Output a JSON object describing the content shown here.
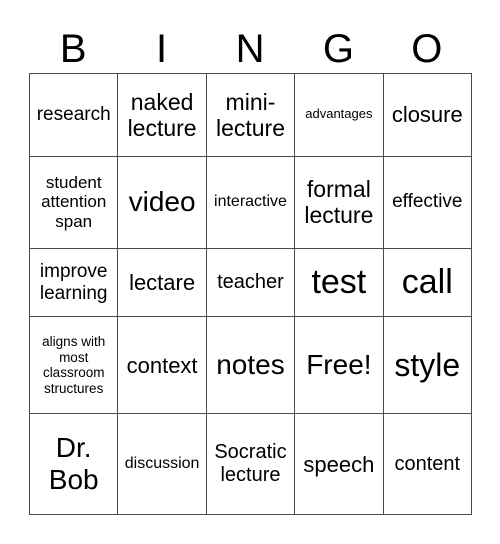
{
  "header": {
    "letters": [
      "B",
      "I",
      "N",
      "G",
      "O"
    ]
  },
  "grid": [
    [
      "research",
      "naked lecture",
      "mini-lecture",
      "advantages",
      "closure"
    ],
    [
      "student attention span",
      "video",
      "interactive",
      "formal lecture",
      "effective"
    ],
    [
      "improve learning",
      "lectare",
      "teacher",
      "test",
      "call"
    ],
    [
      "aligns with most classroom structures",
      "context",
      "notes",
      "Free!",
      "style"
    ],
    [
      "Dr. Bob",
      "discussion",
      "Socratic lecture",
      "speech",
      "content"
    ]
  ]
}
